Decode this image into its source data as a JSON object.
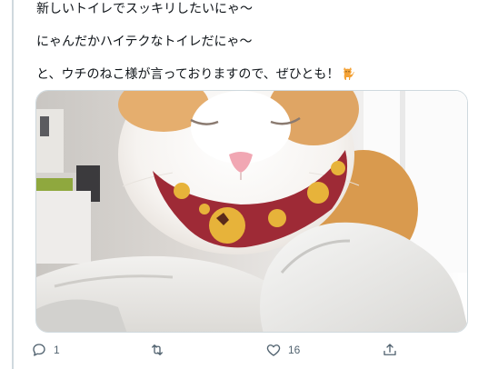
{
  "tweet": {
    "lines": [
      "新しいトイレでスッキリしたいにゃ～",
      "にゃんだかハイテクなトイレだにゃ～",
      "と、ウチのねこ様が言っておりますので、ぜひとも！"
    ],
    "emoji": "cat-emoji"
  },
  "media": {
    "subject": "cat-photo",
    "colors": {
      "border": "#cfd9de"
    }
  },
  "actions": {
    "reply": {
      "icon": "reply-icon",
      "count": "1"
    },
    "retweet": {
      "icon": "retweet-icon",
      "count": ""
    },
    "like": {
      "icon": "heart-icon",
      "count": "16"
    },
    "share": {
      "icon": "share-icon",
      "count": ""
    }
  },
  "colors": {
    "text": "#0f1419",
    "muted": "#536471",
    "thread_line": "#cfd9de"
  }
}
